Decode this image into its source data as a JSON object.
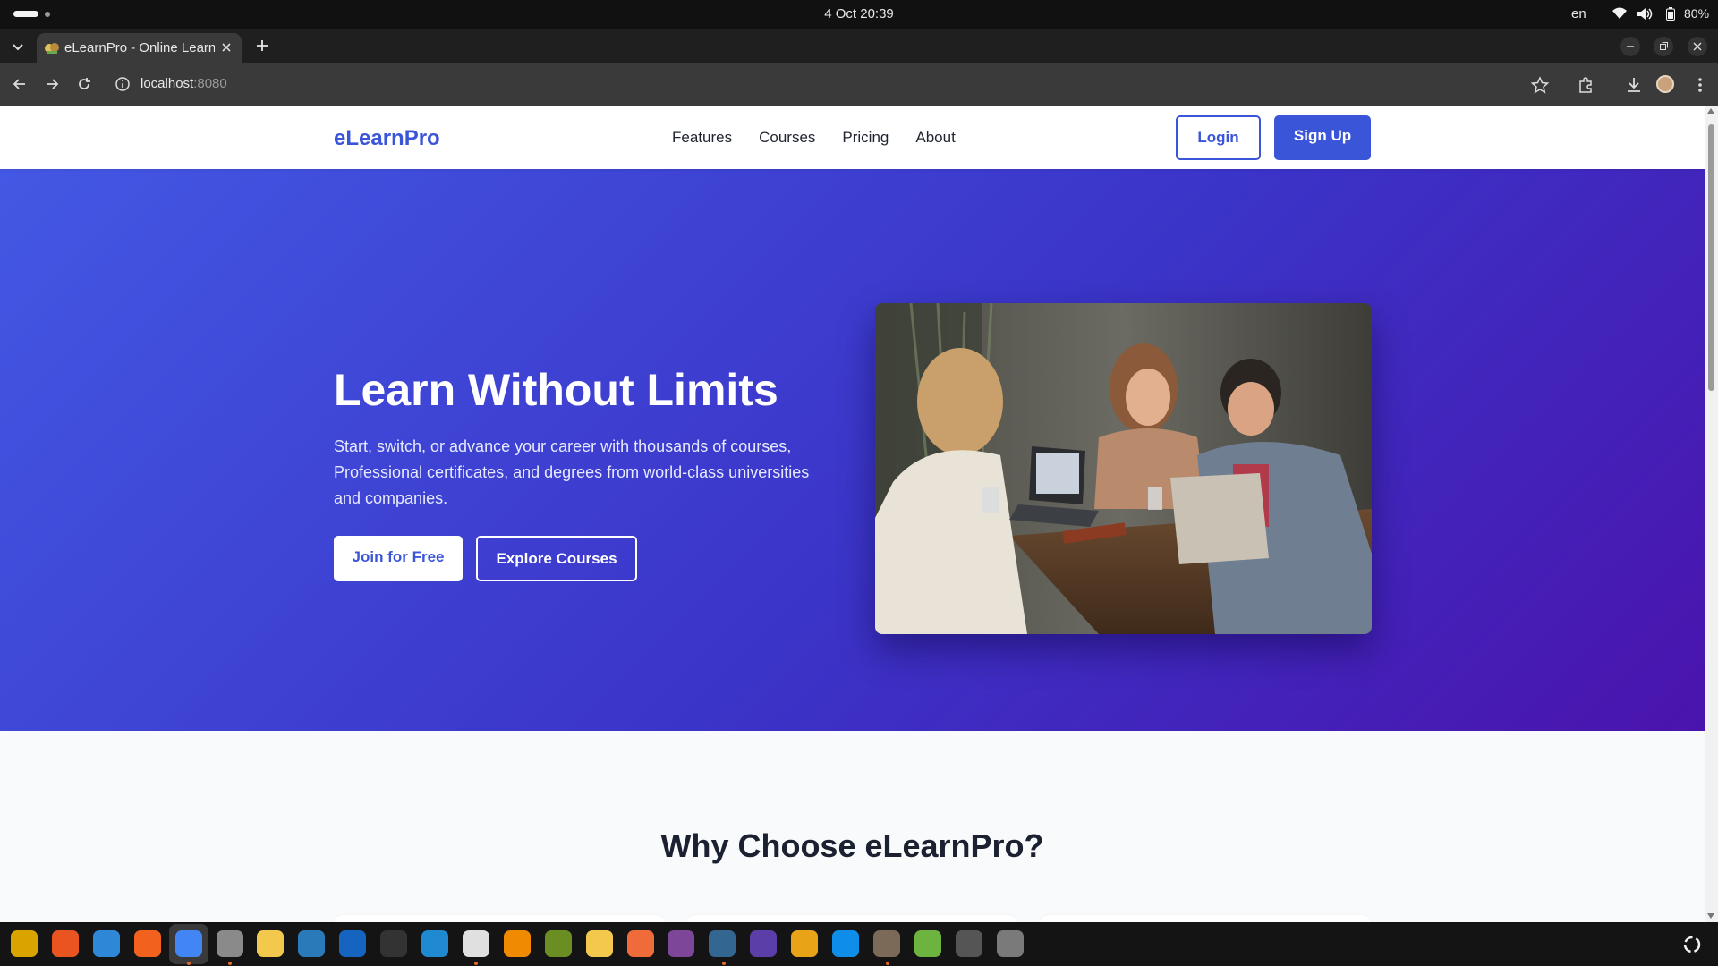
{
  "os_bar": {
    "clock": "4 Oct  20:39",
    "language": "en",
    "battery": "80%"
  },
  "browser": {
    "tab_title": "eLearnPro - Online Learning Platform",
    "url_host": "localhost",
    "url_port": ":8080"
  },
  "site": {
    "logo": "eLearnPro",
    "nav": [
      {
        "label": "Features"
      },
      {
        "label": "Courses"
      },
      {
        "label": "Pricing"
      },
      {
        "label": "About"
      }
    ],
    "login_label": "Login",
    "signup_label": "Sign Up"
  },
  "hero": {
    "title": "Learn Without Limits",
    "subtitle": "Start, switch, or advance your career with thousands of courses, Professional certificates, and degrees from world-class universities and companies.",
    "join_label": "Join for Free",
    "explore_label": "Explore Courses"
  },
  "why": {
    "title": "Why Choose eLearnPro?"
  },
  "colors": {
    "brand": "#3b55d9",
    "hero_start": "#4358e4",
    "hero_end": "#4a13ad"
  },
  "dock_apps": [
    {
      "name": "rhythmbox-icon",
      "color": "#d9a400"
    },
    {
      "name": "app-center-icon",
      "color": "#e95420"
    },
    {
      "name": "help-icon",
      "color": "#2f87d8"
    },
    {
      "name": "firefox-icon",
      "color": "#f2621e"
    },
    {
      "name": "chrome-icon",
      "color": "#4285f4"
    },
    {
      "name": "files-icon",
      "color": "#8a8a8a"
    },
    {
      "name": "text-editor-icon",
      "color": "#f2c94c"
    },
    {
      "name": "writer-icon",
      "color": "#2a7ab9"
    },
    {
      "name": "mysql-workbench-icon",
      "color": "#1565c0"
    },
    {
      "name": "terminal-icon",
      "color": "#333333"
    },
    {
      "name": "vscode-icon",
      "color": "#1f8ad2"
    },
    {
      "name": "notes-icon",
      "color": "#e0e0e0"
    },
    {
      "name": "vlc-icon",
      "color": "#f08a00"
    },
    {
      "name": "network-icon",
      "color": "#6b8e23"
    },
    {
      "name": "calc-icon",
      "color": "#f2c94c"
    },
    {
      "name": "postman-icon",
      "color": "#ef6c3a"
    },
    {
      "name": "tor-icon",
      "color": "#7d4698"
    },
    {
      "name": "postgres-icon",
      "color": "#336791"
    },
    {
      "name": "eclipse-icon",
      "color": "#5c3ea8"
    },
    {
      "name": "archive-icon",
      "color": "#e8a317"
    },
    {
      "name": "teamviewer-icon",
      "color": "#0e8ee9"
    },
    {
      "name": "gimp-icon",
      "color": "#7b6a58"
    },
    {
      "name": "spring-icon",
      "color": "#6db33f"
    },
    {
      "name": "ssd-icon",
      "color": "#555555"
    },
    {
      "name": "trash-icon",
      "color": "#7a7a7a"
    }
  ]
}
